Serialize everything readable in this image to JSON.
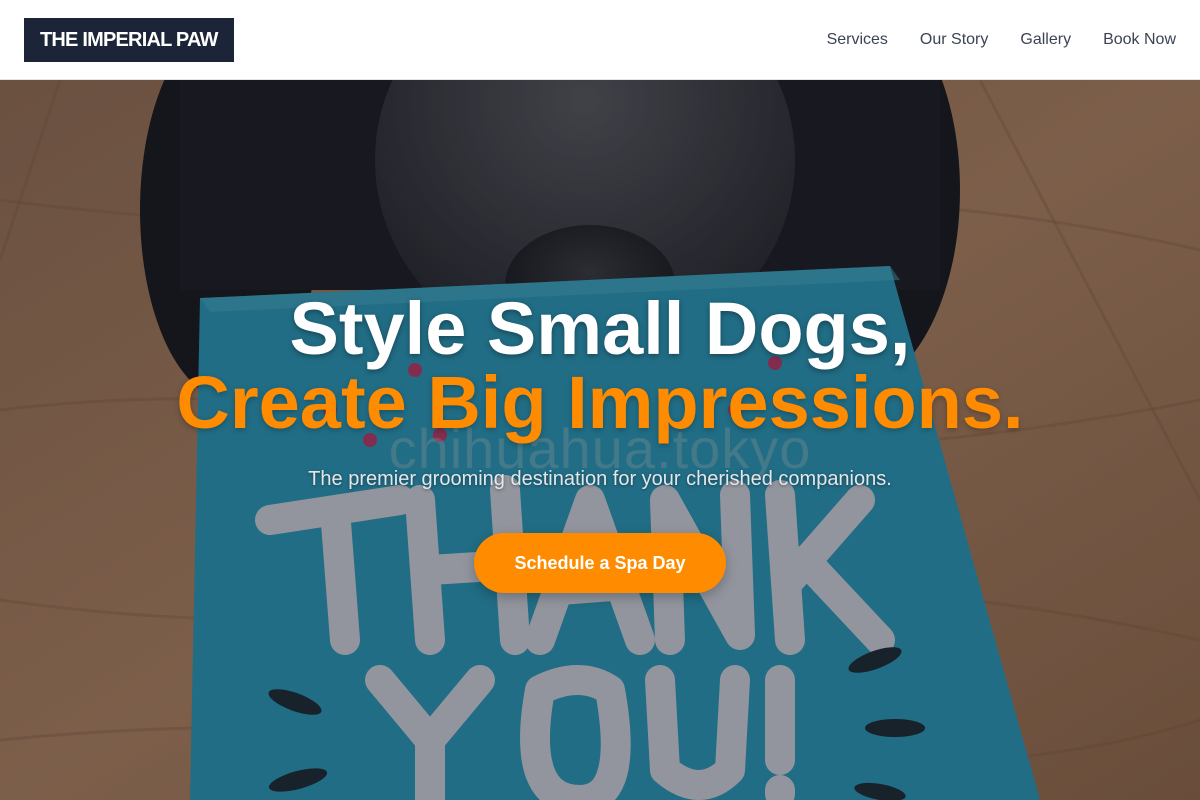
{
  "header": {
    "logo_text": "THE IMPERIAL PAW",
    "nav": [
      {
        "label": "Services"
      },
      {
        "label": "Our Story"
      },
      {
        "label": "Gallery"
      },
      {
        "label": "Book Now"
      }
    ]
  },
  "hero": {
    "headline_line1": "Style Small Dogs,",
    "headline_line2": "Create Big Impressions.",
    "subtitle": "The premier grooming destination for your cherished companions.",
    "cta_label": "Schedule a Spa Day",
    "watermark": "chihuahua.tokyo",
    "background_image_subject": "dog-with-thank-you-card"
  },
  "colors": {
    "accent": "#ff8c00",
    "logo_bg": "#1c2538",
    "nav_text": "#3b4353",
    "header_bg": "#ffffff"
  }
}
